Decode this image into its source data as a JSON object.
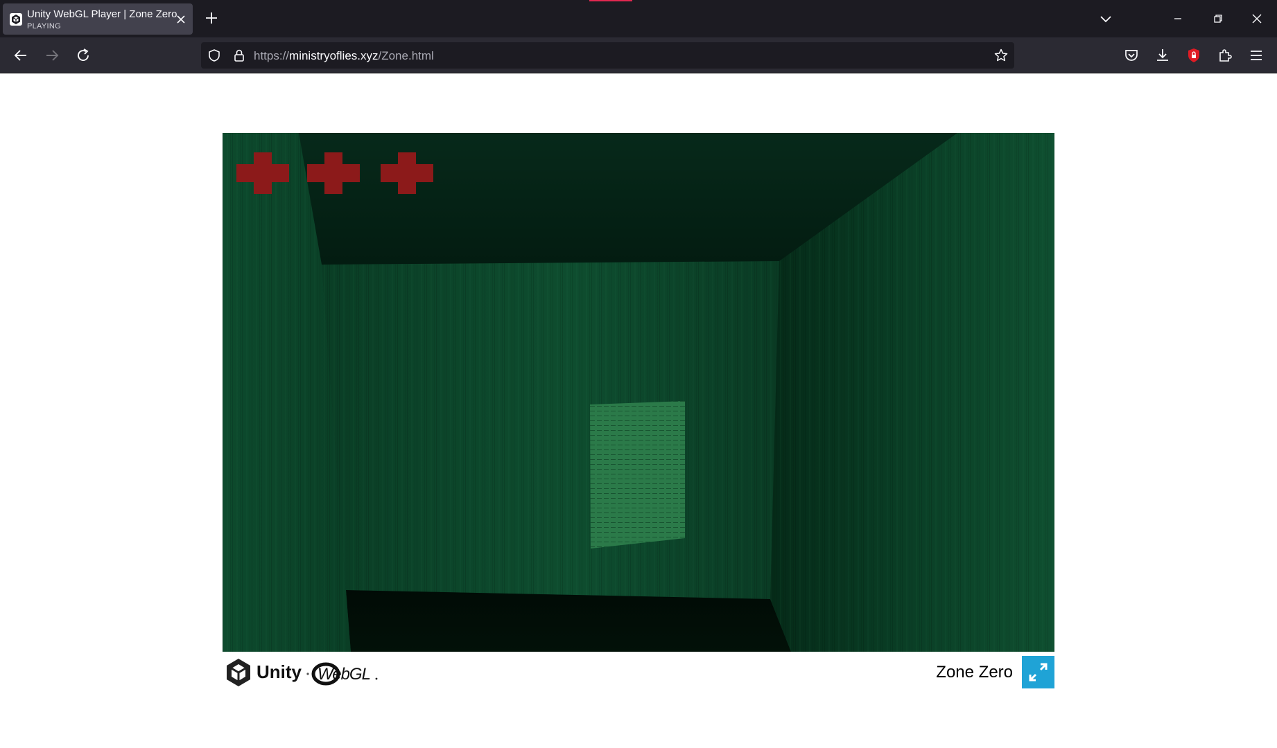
{
  "browser": {
    "tab": {
      "title": "Unity WebGL Player | Zone Zero",
      "status": "PLAYING",
      "favicon": "unity-icon"
    },
    "url": {
      "prefix": "https://",
      "domain": "ministryoflies.xyz",
      "path": "/Zone.html"
    },
    "icons": [
      "back-icon",
      "forward-icon",
      "reload-icon",
      "shield-icon",
      "lock-icon",
      "star-icon",
      "pocket-icon",
      "download-icon",
      "ublock-icon",
      "extensions-icon",
      "menu-icon",
      "list-all-tabs-icon",
      "minimize-icon",
      "restore-icon",
      "close-icon"
    ]
  },
  "game": {
    "health": {
      "hearts": 3,
      "max": 3,
      "color": "#8c1a1a"
    },
    "wall_color": "#0b4a2c",
    "note_color": "#2b7a49"
  },
  "footer": {
    "logo_text": "Unity WebGL",
    "build_title": "Zone Zero",
    "fullscreen_color": "#1fa3d6"
  }
}
